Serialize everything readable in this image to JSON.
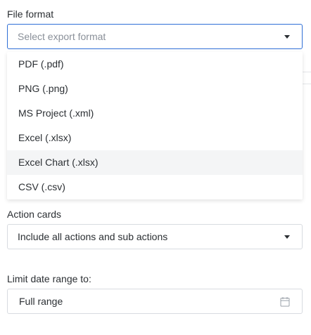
{
  "file_format": {
    "label": "File format",
    "placeholder": "Select export format",
    "options": [
      "PDF (.pdf)",
      "PNG (.png)",
      "MS Project (.xml)",
      "Excel (.xlsx)",
      "Excel Chart (.xlsx)",
      "CSV (.csv)"
    ],
    "hovered_option": "Excel Chart (.xlsx)"
  },
  "action_cards": {
    "label": "Action cards",
    "value": "Include all actions and sub actions"
  },
  "date_range": {
    "label": "Limit date range to:",
    "value": "Full range",
    "icon": "calendar-icon"
  },
  "colors": {
    "focus_border": "#2f6fd6",
    "hover_bg": "#f4f5f6"
  }
}
